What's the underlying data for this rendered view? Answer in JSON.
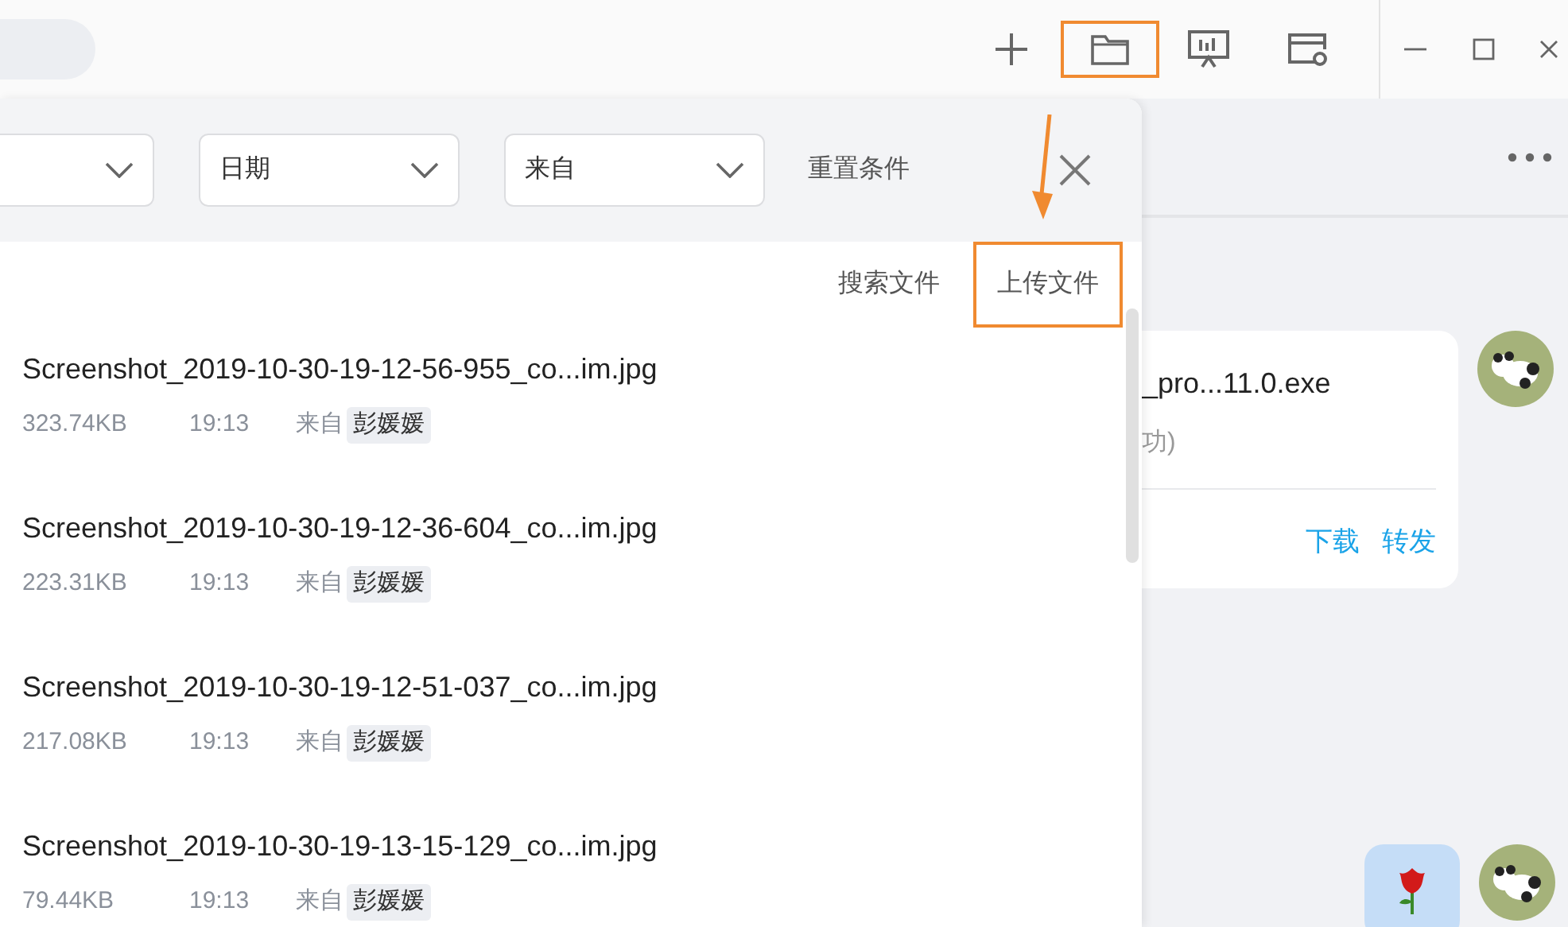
{
  "toolbar_icons": [
    {
      "kind": "plus",
      "highlighted": false
    },
    {
      "kind": "folder",
      "highlighted": true
    },
    {
      "kind": "presentation",
      "highlighted": false
    },
    {
      "kind": "window-settings",
      "highlighted": false
    }
  ],
  "filters": [
    {
      "label": "日期"
    },
    {
      "label": "来自"
    }
  ],
  "reset": "重置条件",
  "actions": [
    {
      "label": "搜索文件",
      "highlighted": false
    },
    {
      "label": "上传文件",
      "highlighted": true
    }
  ],
  "files": [
    {
      "name": "Screenshot_2019-10-30-19-12-56-955_co...im.jpg",
      "size": "323.74KB",
      "time": "19:13",
      "from_label": "来自",
      "sender": "彭媛媛"
    },
    {
      "name": "Screenshot_2019-10-30-19-12-36-604_co...im.jpg",
      "size": "223.31KB",
      "time": "19:13",
      "from_label": "来自",
      "sender": "彭媛媛"
    },
    {
      "name": "Screenshot_2019-10-30-19-12-51-037_co...im.jpg",
      "size": "217.08KB",
      "time": "19:13",
      "from_label": "来自",
      "sender": "彭媛媛"
    },
    {
      "name": "Screenshot_2019-10-30-19-13-15-129_co...im.jpg",
      "size": "79.44KB",
      "time": "19:13",
      "from_label": "来自",
      "sender": "彭媛媛"
    }
  ],
  "chat": {
    "messages": [
      {
        "kind": "file",
        "name": "_pro...11.0.exe",
        "status": "功)",
        "actions": [
          "下载",
          "转发"
        ]
      },
      {
        "kind": "emoji"
      }
    ]
  }
}
